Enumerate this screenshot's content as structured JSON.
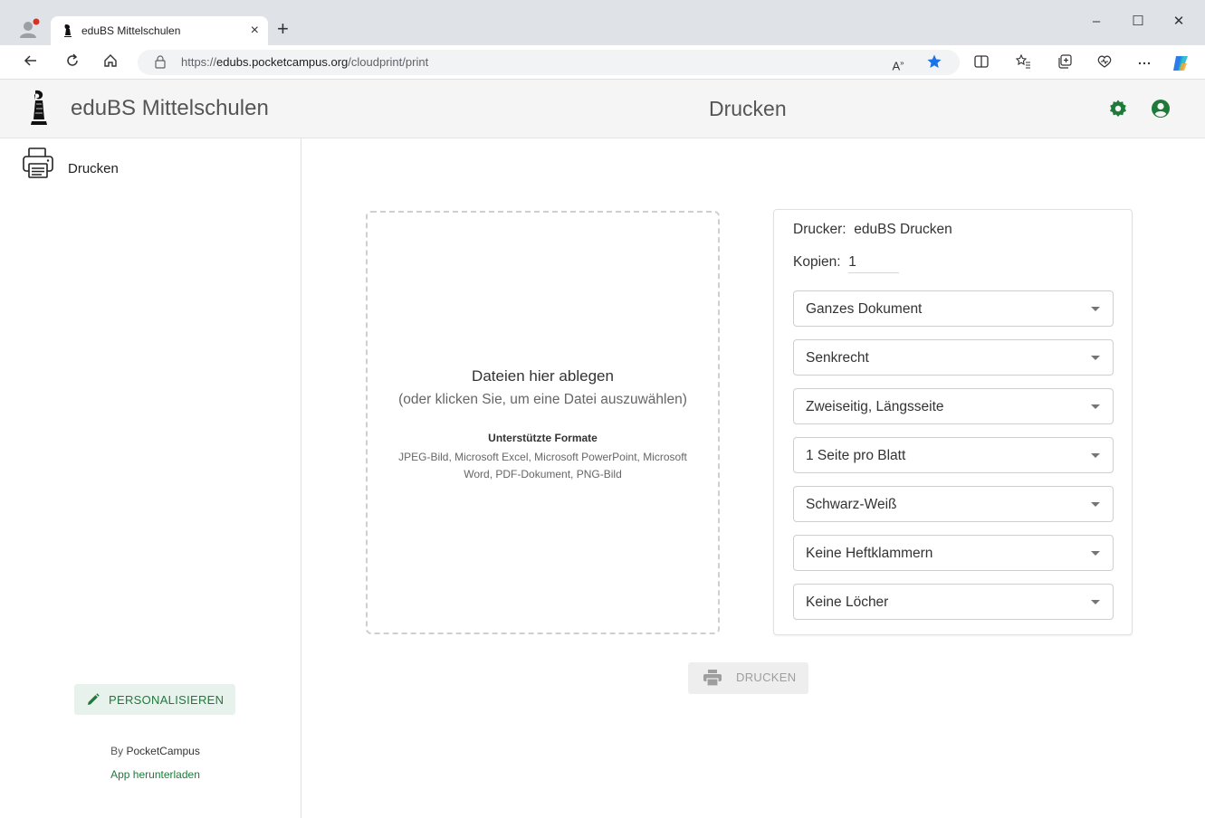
{
  "browser": {
    "tab_title": "eduBS Mittelschulen",
    "tab_close": "×",
    "new_tab": "+",
    "url_prefix": "https://",
    "url_host": "edubs.pocketcampus.org",
    "url_path": "/cloudprint/print",
    "window_controls": {
      "minimize": "–",
      "maximize": "☐",
      "close": "✕"
    }
  },
  "header": {
    "app_title": "eduBS Mittelschulen",
    "page_title": "Drucken"
  },
  "sidebar": {
    "items": [
      {
        "label": "Drucken"
      }
    ],
    "personalize_label": "PERSONALISIEREN",
    "by_prefix": "By ",
    "by_name": "PocketCampus",
    "app_download": "App herunterladen"
  },
  "dropzone": {
    "title": "Dateien hier ablegen",
    "subtitle": "(oder klicken Sie, um eine Datei auszuwählen)",
    "formats_heading": "Unterstützte Formate",
    "formats_list": "JPEG-Bild, Microsoft Excel, Microsoft PowerPoint, Microsoft Word, PDF-Dokument, PNG-Bild"
  },
  "settings": {
    "printer_label": "Drucker:",
    "printer_value": "eduBS Drucken",
    "copies_label": "Kopien:",
    "copies_value": "1",
    "selects": [
      {
        "value": "Ganzes Dokument"
      },
      {
        "value": "Senkrecht"
      },
      {
        "value": "Zweiseitig, Längsseite"
      },
      {
        "value": "1 Seite pro Blatt"
      },
      {
        "value": "Schwarz-Weiß"
      },
      {
        "value": "Keine Heftklammern"
      },
      {
        "value": "Keine Löcher"
      }
    ]
  },
  "print_button": {
    "label": "DRUCKEN",
    "enabled": false
  },
  "colors": {
    "accent_green": "#1f7a3a",
    "header_bg": "#f5f5f5",
    "edge_star": "#1a73e8"
  }
}
